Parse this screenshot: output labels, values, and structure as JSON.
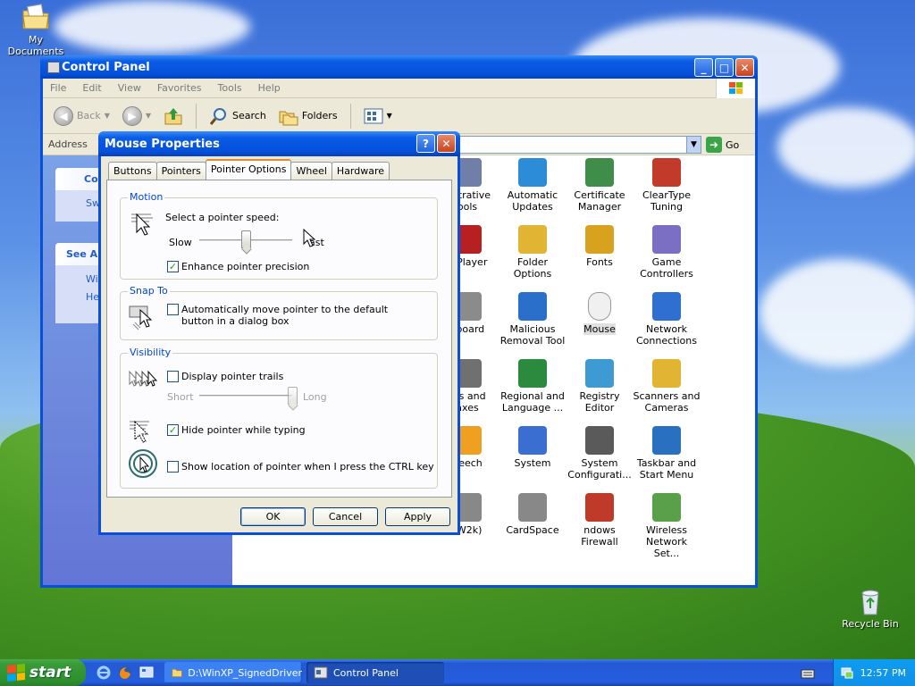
{
  "desktop": {
    "icons": [
      {
        "label": "My Documents",
        "icon": "folder-documents-icon"
      },
      {
        "label": "Recycle Bin",
        "icon": "recycle-bin-icon"
      }
    ]
  },
  "control_panel": {
    "title": "Control Panel",
    "menu": [
      "File",
      "Edit",
      "View",
      "Favorites",
      "Tools",
      "Help"
    ],
    "toolbar": {
      "back": "Back",
      "search": "Search",
      "folders": "Folders"
    },
    "address_label": "Address",
    "go_label": "Go",
    "left_pane": {
      "task_title": "Co",
      "task_link": "Sw",
      "see_also_title": "See Al",
      "see_also_links": [
        "Wi",
        "He"
      ]
    },
    "items": [
      {
        "label": "nistrative\nools",
        "icon": "admin-tools-icon"
      },
      {
        "label": "Automatic\nUpdates",
        "icon": "automatic-updates-icon"
      },
      {
        "label": "Certificate\nManager",
        "icon": "certificate-icon"
      },
      {
        "label": "ClearType\nTuning",
        "icon": "cleartype-icon"
      },
      {
        "label": "h Player",
        "icon": "flash-player-icon"
      },
      {
        "label": "Folder Options",
        "icon": "folder-options-icon"
      },
      {
        "label": "Fonts",
        "icon": "fonts-icon"
      },
      {
        "label": "Game\nControllers",
        "icon": "game-controller-icon"
      },
      {
        "label": "yboard",
        "icon": "keyboard-icon"
      },
      {
        "label": "Malicious\nRemoval Tool",
        "icon": "malicious-removal-icon"
      },
      {
        "label": "Mouse",
        "icon": "mouse-icon"
      },
      {
        "label": "Network\nConnections",
        "icon": "network-icon"
      },
      {
        "label": "ers and\naxes",
        "icon": "printers-icon"
      },
      {
        "label": "Regional and\nLanguage ...",
        "icon": "regional-icon"
      },
      {
        "label": "Registry Editor",
        "icon": "registry-icon"
      },
      {
        "label": "Scanners and\nCameras",
        "icon": "scanner-icon"
      },
      {
        "label": "peech",
        "icon": "speech-icon"
      },
      {
        "label": "System",
        "icon": "system-icon"
      },
      {
        "label": "System\nConfigurati...",
        "icon": "system-config-icon"
      },
      {
        "label": "Taskbar and\nStart Menu",
        "icon": "taskbar-icon"
      },
      {
        "label": "(W2k)",
        "icon": "w2k-icon"
      },
      {
        "label": "CardSpace",
        "icon": "cardspace-icon"
      },
      {
        "label": "ndows\nFirewall",
        "icon": "firewall-icon"
      },
      {
        "label": "Wireless\nNetwork Set...",
        "icon": "wireless-icon"
      }
    ]
  },
  "dialog": {
    "title": "Mouse Properties",
    "tabs": [
      "Buttons",
      "Pointers",
      "Pointer Options",
      "Wheel",
      "Hardware"
    ],
    "active_tab": "Pointer Options",
    "motion": {
      "group_label": "Motion",
      "speed_label": "Select a pointer speed:",
      "slow": "Slow",
      "fast": "ast",
      "speed_value": 0.5,
      "enhance_label": "Enhance pointer precision",
      "enhance_checked": true
    },
    "snap_to": {
      "group_label": "Snap To",
      "label": "Automatically move pointer to the default button in a dialog box",
      "checked": false
    },
    "visibility": {
      "group_label": "Visibility",
      "trails_label": "Display pointer trails",
      "trails_checked": false,
      "short": "Short",
      "long": "Long",
      "trails_value": 1.0,
      "hide_label": "Hide pointer while typing",
      "hide_checked": true,
      "ctrl_label": "Show location of pointer when I press the CTRL key",
      "ctrl_checked": false
    },
    "buttons": {
      "ok": "OK",
      "cancel": "Cancel",
      "apply": "Apply"
    }
  },
  "taskbar": {
    "start": "start",
    "tasks": [
      {
        "label": "D:\\WinXP_SignedDriver",
        "active": false
      },
      {
        "label": "Control Panel",
        "active": true
      }
    ],
    "clock": "12:57 PM"
  }
}
